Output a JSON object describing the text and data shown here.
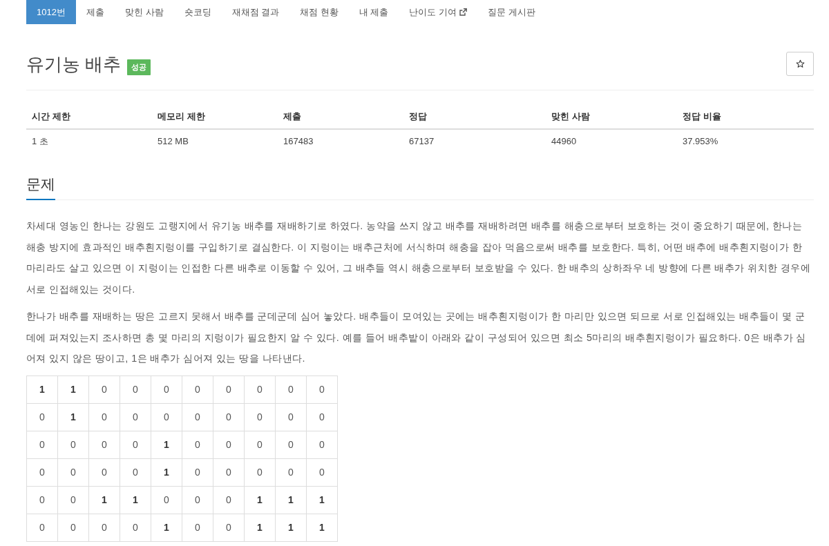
{
  "nav": {
    "tabs": [
      {
        "label": "1012번",
        "selected": true
      },
      {
        "label": "제출",
        "selected": false
      },
      {
        "label": "맞힌 사람",
        "selected": false
      },
      {
        "label": "숏코딩",
        "selected": false
      },
      {
        "label": "재채점 결과",
        "selected": false
      },
      {
        "label": "채점 현황",
        "selected": false
      },
      {
        "label": "내 제출",
        "selected": false
      },
      {
        "label": "난이도 기여",
        "selected": false,
        "external": true
      },
      {
        "label": "질문 게시판",
        "selected": false
      }
    ]
  },
  "problem": {
    "title": "유기농 배추",
    "result_badge": "성공"
  },
  "stats": {
    "columns": [
      "시간 제한",
      "메모리 제한",
      "제출",
      "정답",
      "맞힌 사람",
      "정답 비율"
    ],
    "rows": [
      [
        "1 초",
        "512 MB",
        "167483",
        "67137",
        "44960",
        "37.953%"
      ]
    ]
  },
  "description": {
    "heading": "문제",
    "paragraphs": [
      "차세대 영농인 한나는 강원도 고랭지에서 유기농 배추를 재배하기로 하였다. 농약을 쓰지 않고 배추를 재배하려면 배추를 해충으로부터 보호하는 것이 중요하기 때문에, 한나는 해충 방지에 효과적인 배추흰지렁이를 구입하기로 결심한다. 이 지렁이는 배추근처에 서식하며 해충을 잡아 먹음으로써 배추를 보호한다. 특히, 어떤 배추에 배추흰지렁이가 한 마리라도 살고 있으면 이 지렁이는 인접한 다른 배추로 이동할 수 있어, 그 배추들 역시 해충으로부터 보호받을 수 있다. 한 배추의 상하좌우 네 방향에 다른 배추가 위치한 경우에 서로 인접해있는 것이다.",
      "한나가 배추를 재배하는 땅은 고르지 못해서 배추를 군데군데 심어 놓았다. 배추들이 모여있는 곳에는 배추흰지렁이가 한 마리만 있으면 되므로 서로 인접해있는 배추들이 몇 군데에 퍼져있는지 조사하면 총 몇 마리의 지렁이가 필요한지 알 수 있다. 예를 들어 배추밭이 아래와 같이 구성되어 있으면 최소 5마리의 배추흰지렁이가 필요하다. 0은 배추가 심어져 있지 않은 땅이고, 1은 배추가 심어져 있는 땅을 나타낸다."
    ],
    "grid": {
      "rows": [
        [
          {
            "text": "1",
            "planted": true
          },
          {
            "text": "1",
            "planted": true
          },
          {
            "text": "0",
            "planted": false
          },
          {
            "text": "0",
            "planted": false
          },
          {
            "text": "0",
            "planted": false
          },
          {
            "text": "0",
            "planted": false
          },
          {
            "text": "0",
            "planted": false
          },
          {
            "text": "0",
            "planted": false
          },
          {
            "text": "0",
            "planted": false
          },
          {
            "text": "0",
            "planted": false
          }
        ],
        [
          {
            "text": "0",
            "planted": false
          },
          {
            "text": "1",
            "planted": true
          },
          {
            "text": "0",
            "planted": false
          },
          {
            "text": "0",
            "planted": false
          },
          {
            "text": "0",
            "planted": false
          },
          {
            "text": "0",
            "planted": false
          },
          {
            "text": "0",
            "planted": false
          },
          {
            "text": "0",
            "planted": false
          },
          {
            "text": "0",
            "planted": false
          },
          {
            "text": "0",
            "planted": false
          }
        ],
        [
          {
            "text": "0",
            "planted": false
          },
          {
            "text": "0",
            "planted": false
          },
          {
            "text": "0",
            "planted": false
          },
          {
            "text": "0",
            "planted": false
          },
          {
            "text": "1",
            "planted": true
          },
          {
            "text": "0",
            "planted": false
          },
          {
            "text": "0",
            "planted": false
          },
          {
            "text": "0",
            "planted": false
          },
          {
            "text": "0",
            "planted": false
          },
          {
            "text": "0",
            "planted": false
          }
        ],
        [
          {
            "text": "0",
            "planted": false
          },
          {
            "text": "0",
            "planted": false
          },
          {
            "text": "0",
            "planted": false
          },
          {
            "text": "0",
            "planted": false
          },
          {
            "text": "1",
            "planted": true
          },
          {
            "text": "0",
            "planted": false
          },
          {
            "text": "0",
            "planted": false
          },
          {
            "text": "0",
            "planted": false
          },
          {
            "text": "0",
            "planted": false
          },
          {
            "text": "0",
            "planted": false
          }
        ],
        [
          {
            "text": "0",
            "planted": false
          },
          {
            "text": "0",
            "planted": false
          },
          {
            "text": "1",
            "planted": true
          },
          {
            "text": "1",
            "planted": true
          },
          {
            "text": "0",
            "planted": false
          },
          {
            "text": "0",
            "planted": false
          },
          {
            "text": "0",
            "planted": false
          },
          {
            "text": "1",
            "planted": true
          },
          {
            "text": "1",
            "planted": true
          },
          {
            "text": "1",
            "planted": true
          }
        ],
        [
          {
            "text": "0",
            "planted": false
          },
          {
            "text": "0",
            "planted": false
          },
          {
            "text": "0",
            "planted": false
          },
          {
            "text": "0",
            "planted": false
          },
          {
            "text": "1",
            "planted": true
          },
          {
            "text": "0",
            "planted": false
          },
          {
            "text": "0",
            "planted": false
          },
          {
            "text": "1",
            "planted": true
          },
          {
            "text": "1",
            "planted": true
          },
          {
            "text": "1",
            "planted": true
          }
        ]
      ]
    }
  }
}
